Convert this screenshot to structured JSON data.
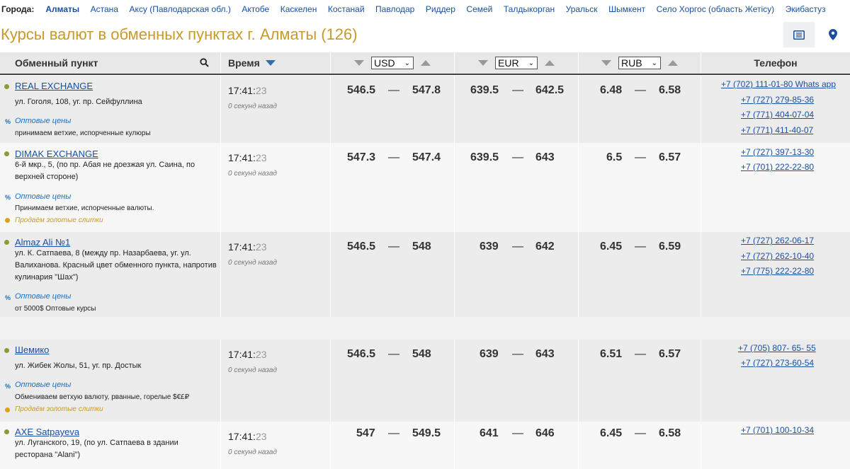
{
  "cities_label": "Города:",
  "cities": [
    "Алматы",
    "Астана",
    "Аксу (Павлодарская обл.)",
    "Актобе",
    "Каскелен",
    "Костанай",
    "Павлодар",
    "Риддер",
    "Семей",
    "Талдыкорган",
    "Уральск",
    "Шымкент",
    "Село Хоргос (область Жетісу)",
    "Экибастуз"
  ],
  "active_city": "Алматы",
  "title": "Курсы валют в обменных пунктах г. Алматы (126)",
  "header": {
    "point": "Обменный пункт",
    "time": "Время",
    "usd": "USD",
    "eur": "EUR",
    "rub": "RUB",
    "phone": "Телефон"
  },
  "rows": [
    {
      "name": "REAL EXCHANGE",
      "address": "ул. Гоголя, 108, уг. пр. Сейфуллина",
      "wholesale": "Оптовые цены",
      "note": "принимаем ветхие, испорченные кулюры",
      "gold": "",
      "time_hm": "17:41:",
      "time_s": "23",
      "ago": "0 секунд назад",
      "usd": [
        "546.5",
        "547.8"
      ],
      "eur": [
        "639.5",
        "642.5"
      ],
      "rub": [
        "6.48",
        "6.58"
      ],
      "phones": [
        "+7 (702) 111-01-80 Whats app",
        "+7 (727) 279-85-36",
        "+7 (771) 404-07-04",
        "+7 (771) 411-40-07"
      ]
    },
    {
      "name": "DIMAK EXCHANGE",
      "address": "6-й мкр., 5, (по пр. Абая не доезжая ул. Саина, по верхней стороне)",
      "wholesale": "Оптовые цены",
      "note": "Принимаем ветхие, испорченные валюты.",
      "gold": "Продаём золотые слитки",
      "time_hm": "17:41:",
      "time_s": "23",
      "ago": "0 секунд назад",
      "usd": [
        "547.3",
        "547.4"
      ],
      "eur": [
        "639.5",
        "643"
      ],
      "rub": [
        "6.5",
        "6.57"
      ],
      "phones": [
        "+7 (727) 397-13-30",
        "+7 (701) 222-22-80"
      ]
    },
    {
      "name": "Almaz Ali №1",
      "address": "ул. К. Сатпаева, 8 (между пр. Назарбаева, уг. ул. Валиханова. Красный цвет обменного пункта, напротив кулинария \"Шах\")",
      "wholesale": "Оптовые цены",
      "note": "от 5000$ Оптовые курсы",
      "gold": "",
      "time_hm": "17:41:",
      "time_s": "23",
      "ago": "0 секунд назад",
      "usd": [
        "546.5",
        "548"
      ],
      "eur": [
        "639",
        "642"
      ],
      "rub": [
        "6.45",
        "6.59"
      ],
      "phones": [
        "+7 (727) 262-06-17",
        "+7 (727) 262-10-40",
        "+7 (775) 222-22-80"
      ]
    },
    {
      "name": "Шемико",
      "address": "ул. Жибек Жолы, 51, уг. пр. Достык",
      "wholesale": "Оптовые цены",
      "note": "Обмениваем ветхую валюту, рванные, горелые $€£₽",
      "gold": "Продаём золотые слитки",
      "time_hm": "17:41:",
      "time_s": "23",
      "ago": "0 секунд назад",
      "usd": [
        "546.5",
        "548"
      ],
      "eur": [
        "639",
        "643"
      ],
      "rub": [
        "6.51",
        "6.57"
      ],
      "phones": [
        "+7 (705) 807- 65- 55",
        "+7 (727) 273-60-54"
      ]
    },
    {
      "name": "AXE Satpayeva",
      "address": "ул. Луганского, 19, (по ул. Сатпаева в здании ресторана \"Alani\")",
      "wholesale": "",
      "note": "",
      "gold": "",
      "time_hm": "17:41:",
      "time_s": "23",
      "ago": "0 секунд назад",
      "usd": [
        "547",
        "549.5"
      ],
      "eur": [
        "641",
        "646"
      ],
      "rub": [
        "6.45",
        "6.58"
      ],
      "phones": [
        "+7 (701) 100-10-34"
      ]
    }
  ],
  "colors": {
    "title": "#c9992a",
    "link": "#1a4fa0",
    "gold": "#c9992a",
    "dot": "#8b9b3a"
  },
  "icons": {
    "search": "search-icon",
    "list": "list-view-icon",
    "map": "map-pin-icon",
    "sort": "sort-desc-icon"
  }
}
